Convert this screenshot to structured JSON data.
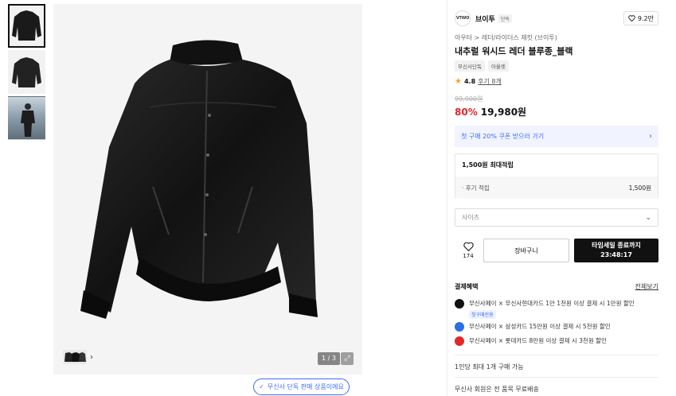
{
  "thumbnails": [
    {
      "name": "thumbnail-1",
      "active": true
    },
    {
      "name": "thumbnail-2",
      "active": false
    },
    {
      "name": "thumbnail-3",
      "active": false
    }
  ],
  "gallery": {
    "counter": "1 / 3",
    "exclusive_notice": "무신사 단독 판매 상품이에요"
  },
  "brand": {
    "logo_text": "VTWO",
    "name": "브이투",
    "badge": "단독",
    "likes": "9.2만"
  },
  "product": {
    "breadcrumb": "아우터 > 레더/라이더스 재킷 (브이투)",
    "title": "내추럴 워시드 레더 블루종_블랙",
    "tags": [
      "무신사단독",
      "아울렛"
    ],
    "rating": "4.8",
    "reviews": "후기 8개",
    "original_price": "99,900원",
    "discount": "80%",
    "price": "19,980원"
  },
  "coupon": {
    "label": "첫 구매 20% 쿠폰 받으러 가기"
  },
  "points": {
    "header": "1,500원 최대적립",
    "row_label": "· 후기 적립",
    "row_amount": "1,500원"
  },
  "size": {
    "placeholder": "사이즈"
  },
  "actions": {
    "likes": "174",
    "cart": "장바구니",
    "buy_line1": "타임세일 종료까지",
    "buy_line2": "23:48:17"
  },
  "benefits": {
    "title": "결제혜택",
    "view_all": "전체보기",
    "items": [
      {
        "text": "무신사페이 × 무신사현대카드 1만 1천원 이상 결제 시 1만원 할인",
        "badge": "첫구매전용"
      },
      {
        "text": "무신사페이 × 삼성카드 15만원 이상 결제 시 5천원 할인",
        "badge": ""
      },
      {
        "text": "무신사페이 × 롯데카드 8만원 이상 결제 시 3천원 할인",
        "badge": ""
      }
    ]
  },
  "purchase_limit": "1인당 최대 1개 구매 가능",
  "shipping": "무신사 회원은 전 품목 무료배송",
  "colors": {
    "accent_blue": "#3d6bff",
    "discount_red": "#e3232c",
    "buy_button": "#111111"
  }
}
